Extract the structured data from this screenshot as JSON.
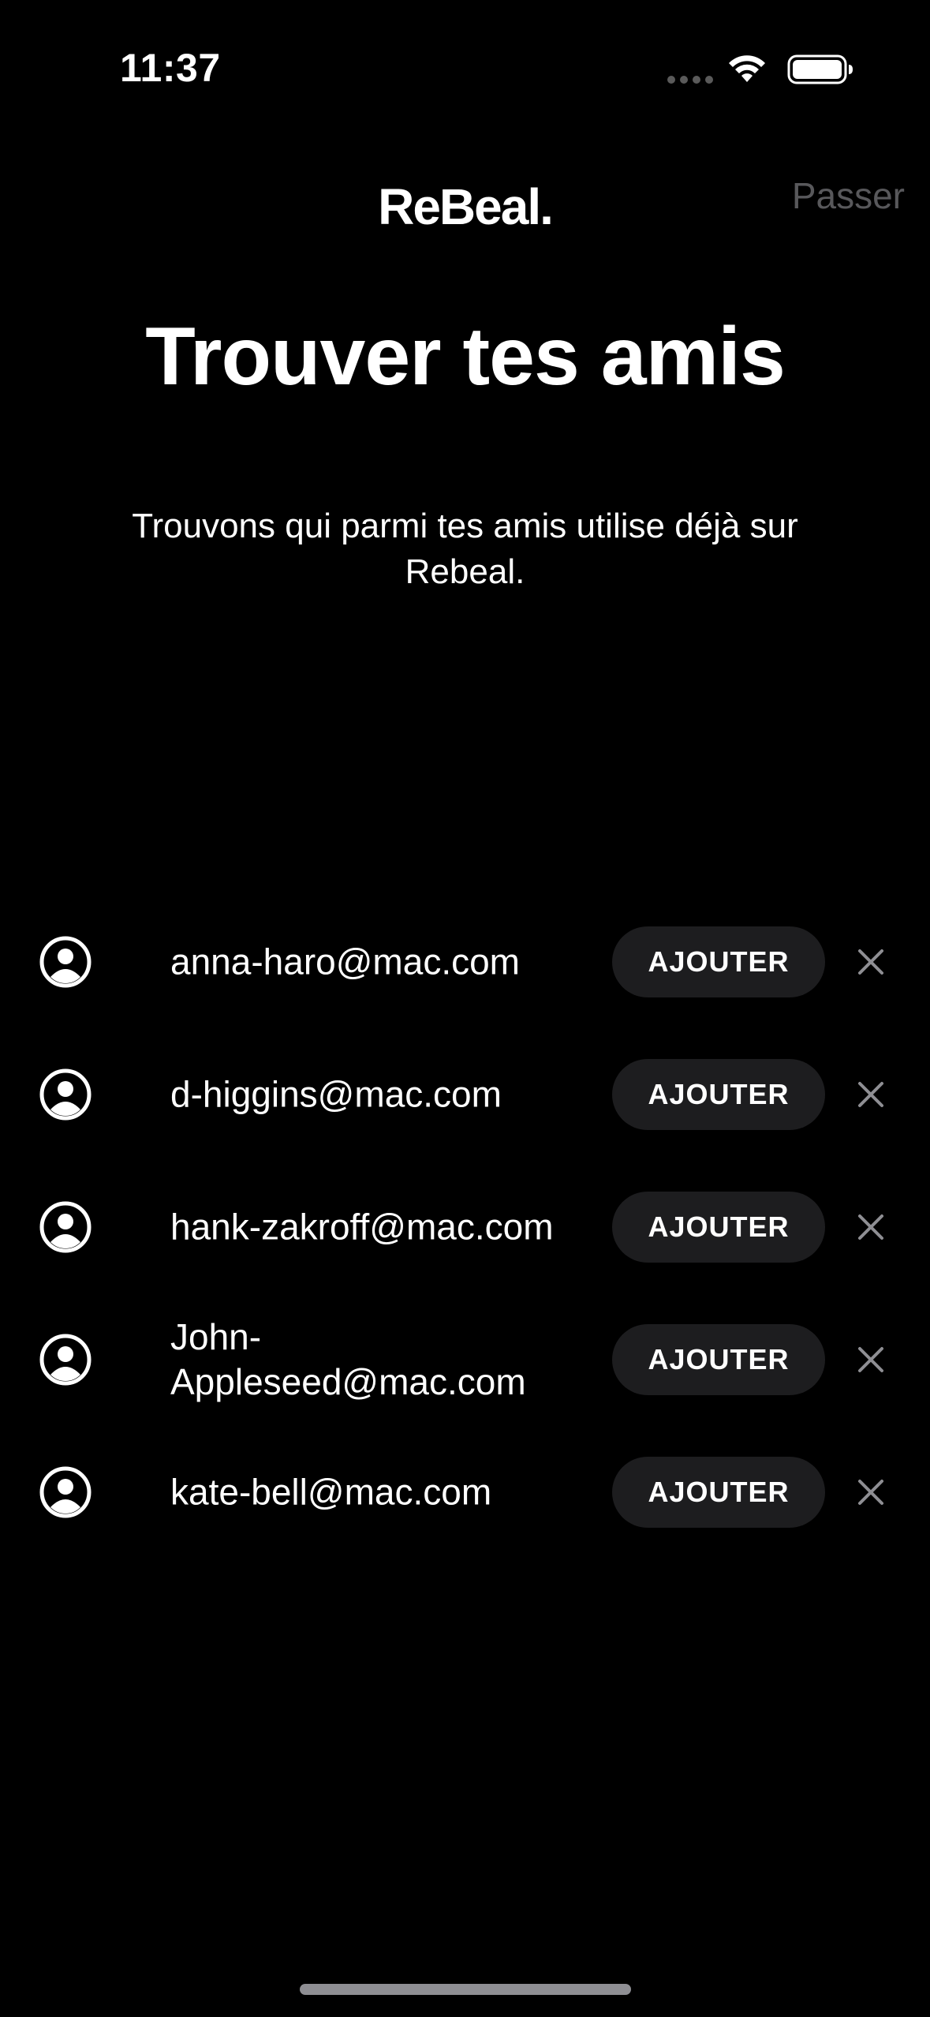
{
  "status_bar": {
    "time": "11:37"
  },
  "header": {
    "brand": "ReBeal.",
    "skip_label": "Passer"
  },
  "main": {
    "title": "Trouver tes amis",
    "subtitle": "Trouvons qui parmi tes amis utilise déjà sur Rebeal."
  },
  "contacts": [
    {
      "email": "anna-haro@mac.com",
      "add_label": "AJOUTER"
    },
    {
      "email": "d-higgins@mac.com",
      "add_label": "AJOUTER"
    },
    {
      "email": "hank-zakroff@mac.com",
      "add_label": "AJOUTER"
    },
    {
      "email": "John-Appleseed@mac.com",
      "add_label": "AJOUTER"
    },
    {
      "email": "kate-bell@mac.com",
      "add_label": "AJOUTER"
    }
  ],
  "icons": {
    "avatar": "person-circle-icon",
    "dismiss": "close-icon",
    "wifi": "wifi-icon",
    "battery": "battery-icon"
  },
  "colors": {
    "background": "#000000",
    "button_bg": "#1d1d1f",
    "skip_text": "#58585b",
    "dismiss_icon": "#8e8e93"
  }
}
